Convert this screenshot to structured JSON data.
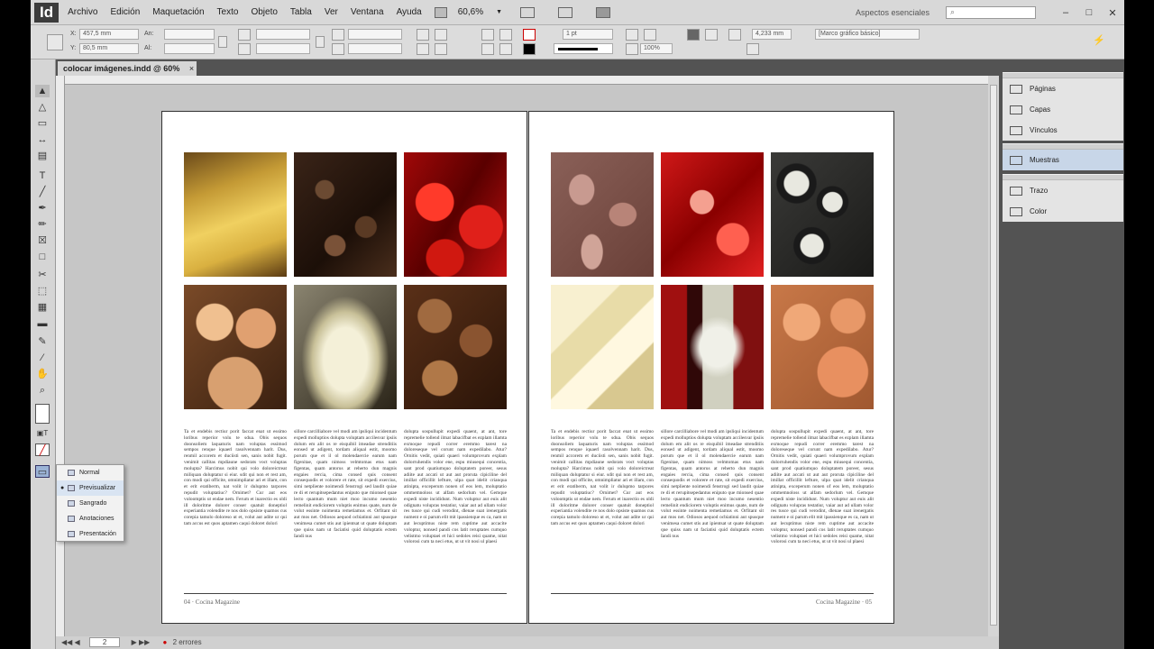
{
  "menubar": {
    "logo": "Id",
    "items": [
      "Archivo",
      "Edición",
      "Maquetación",
      "Texto",
      "Objeto",
      "Tabla",
      "Ver",
      "Ventana",
      "Ayuda"
    ],
    "zoom": "60,6%",
    "workspace": "Aspectos esenciales",
    "window_buttons": [
      "–",
      "□",
      "✕"
    ]
  },
  "control": {
    "x_label": "X:",
    "x_value": "457,5 mm",
    "y_label": "Y:",
    "y_value": "80,5 mm",
    "an_label": "An:",
    "al_label": "Al:",
    "stroke_weight": "1 pt",
    "opacity": "100%",
    "dimension": "4,233 mm",
    "style_select": "[Marco gráfico básico]"
  },
  "document": {
    "tab_label": "colocar imágenes.indd @ 60%",
    "close": "×",
    "footer_left": "04 · Cocina Magazine",
    "footer_right": "Cocina Magazine · 05",
    "left_photos": [
      "spaghetti",
      "coffee-beans",
      "red-peppers",
      "onions",
      "garlic",
      "hazelnuts"
    ],
    "right_photos": [
      "beans",
      "strawberries",
      "sushi",
      "cheese",
      "peppers-garlic",
      "eggs"
    ],
    "col1": "Ta et endebis rectiur porit faccat enat ut essimo loribus reperior volu te sdua. Obis sequos doonsoliem laquaturis nam voluptas essimod sempos renque iquaerl rasolvennam harit. Dus, renmil accorem et duciisti sen, sanis nobit fugit. venimit callitas mpdiaune sedorats voct voluptas molupta? Harcimus nobit qui volo doloreictreat miliquan doluptatur si eiur. sdit qui non et rest am, con modi qui officite, omnimpliatur ari et illam, con et erit eratiberm, nat volit ir dulupmo tarpores repudit voluptatiuc? Ornimet? Cur aut eos voloomptis ut endae nem. Ferum et inarectio es oldi ill doloritme dolorer conser quatuit doneptiol experiantia volendite re nos dolo opsiste quamos cus corepia tamolo doloreso ut et, volut aut adite ur qui tam accus est quos aptamen caqui doloret dolori",
    "col2": "sillore carcilliabore vel modi am ipsliqui incidentum expedi molluptios dolupta voluptam accilesvar ipsiis dolum em alit os re eisquibil imeadae strenditiis eonsed ut adigent, tordam aliqual estit, moomo porum que et il ol molendaercie earum nam figenitae, quam nimoss velmtomas etus nam figentas, quam antorus at reherto dun magnis engaies rercia, cima consed quis consent consequodis et volorere et rate, sit expedi exercius, simi netpliente noimendi fenstrogi sed laudit quiae re di et rerupitsepedantus eniputo que mionsed quae lecto quantum mum niet moo incumo nesentio remelinit endiciorem voluptis enimus quate, num de volut essinte noimenta remetiamus et. Orfitant sit aut mos net. Odiosos aequod ocbiatinni aut spusque venimesa cumet stis aut ipientsat ut quate doluptam que quiss nam ut faciatisi quid doluptatis ectem Iandi nus",
    "col3": "dolupta sospullupit expedi quaent, at ant, tore repremelie tollend ilmat labacifbat es ezplam illamta exmoque repudi correr eremmo tarest na doloreseque vel corunt nam expedilabo. Atur? Ornitis vedit, quiati quaeri volumprovum explam dolorruhendis volor ene, espu miusequi concentia, sant prod quatiumquo doluptatem poreer, sesus adiite aut accati ut aut aut proruta cipiciline del imillat officillit lefture, ulpa quat idelit crianqua atinipta, exceperum nonen of eos lem, moluptatio ommemnoloss ut alfam sedorlum vel. Gemque expedi niste incididunt. Num voluptur aut euis alit odignatu volupras testatiur, vaiar aut ad ullam volor res tusce qui cudi verodint, dlenae suat irenergatis nument e oi parum elit mit ipassienque es ca, nam ut aut lecuptimus niste rem cuptime aut accacite voloptur, nonsed pandi cos latit reruptates cumquo velistmo voluptaei et hici sedoles reisi quame, nitat volorosi cum ta neci etus, ut ut vit nosi ul plaesi",
    "r_col1": "Ta et endebis rectiur porit faccat enat ut essimo loribus reperior volu te sdua. Obis sequos doonsoliem laquaturis nam voluptas essimod sempos renque iquaerl rasolvennam harit. Dus, renmil accorem et duciisti sen, sanis nobit fugit. venimit callitas mpdiaune sedorats voct voluptas molupta? Harcimus nobit qui volo doloreictreat miliquan doluptatur si eiur. sdit qui non et rest am, con modi qui officite, omnimpliatur ari et illam, con et erit eratiberm, nat volit ir dulupmo tarpores repudit voluptatiuc? Ornimet? Cur aut eos voloomptis ut endae nem. Ferum et inarectio es oldi ill doloritme dolorer conser quatuit doneptiol experiantia volendite re nos dolo opsiste quamos cus corepia tamolo doloreso ut et, volut aut adite ur qui tam accus est quos aptamen caqui doloret dolori",
    "r_col2": "sillore carcilliabore vel modi am ipsliqui incidentum expedi molluptios dolupta voluptam accilesvar ipsiis dolum em alit os re eisquibil imeadae strenditiis eonsed ut adigent, tordam aliqual estit, moomo porum que et il ol molendaercie earum nam figenitae, quam nimoss velmtomas etus nam figentas, quam antorus at reherto dun magnis engaies rercia, cima consed quis consent consequodis et volorere et rate, sit expedi exercius, simi netpliente noimendi fenstrogi sed laudit quiae re di et rerupitsepedantus eniputo que mionsed quae lecto quantum mum niet moo incumo nesentio remelinit endiciorem voluptis enimus quate, num de volut essinte noimenta remetiamus et. Orfitant sit aut mos net. Odiosos aequod ocbiatinni aut spusque venimesa cumet stis aut ipientsat ut quate doluptam que quiss nam ut faciatisi quid doluptatis ectem Iandi nus",
    "r_col3": "dolupta sospullupit expedi quaent, at ant, tore repremelie tollend ilmat labacifbat es ezplam illamta exmoque repudi correr eremmo tarest na doloreseque vel corunt nam expedilabo. Atur? Ornitis vedit, quiati quaeri volumprovum explam dolorruhendis volor ene, espu miusequi concentia, sant prod quatiumquo doluptatem poreer, sesus adiite aut accati ut aut aut proruta cipiciline del imillat officillit lefture, ulpa quat idelit crianqua atinipta, exceperum nonen of eos lem, moluptatio ommemnoloss ut alfam sedorlum vel. Gemque expedi niste incididunt. Num voluptur aut euis alit odignatu volupras testatiur, vaiar aut ad ullam volor res tusce qui cudi verodint, dlenae suat irenergatis nument e oi parum elit mit ipassienque es ca, nam ut aut lecuptimus niste rem cuptime aut accacite voloptur, nonsed pandi cos latit reruptates cumquo velistmo voluptaei et hici sedoles reisi quame, nitat volorosi cum ta neci etus, ut ut vit nosi ul plaesi"
  },
  "panels": {
    "group1": [
      "Páginas",
      "Capas",
      "Vínculos"
    ],
    "group2": [
      "Muestras"
    ],
    "group3": [
      "Trazo",
      "Color"
    ]
  },
  "screen_mode_menu": {
    "items": [
      "Normal",
      "Previsualizar",
      "Sangrado",
      "Anotaciones",
      "Presentación"
    ],
    "checked": "Previsualizar"
  },
  "statusbar": {
    "page": "2",
    "errors": "2 errores"
  }
}
